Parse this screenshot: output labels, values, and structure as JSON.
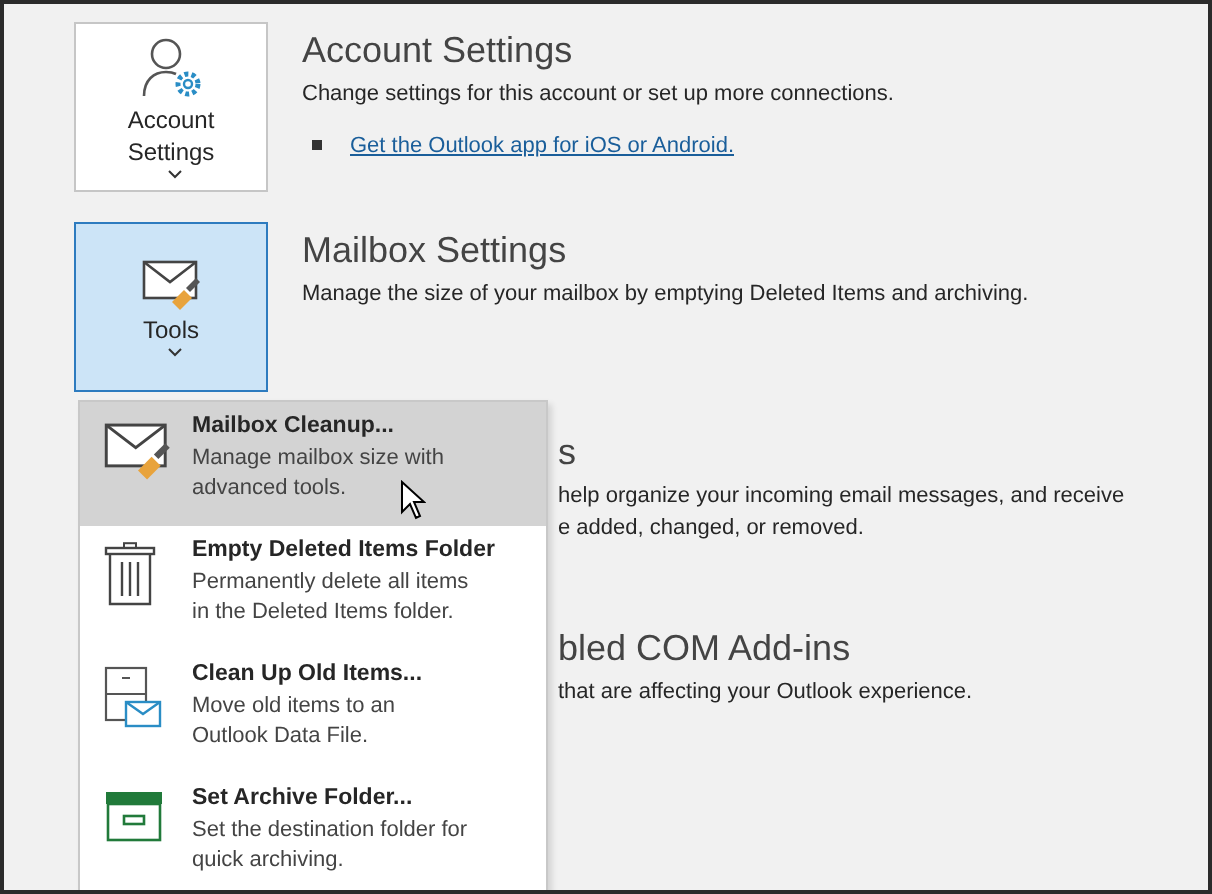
{
  "sections": [
    {
      "button": {
        "label": "Account Settings",
        "selected": false
      },
      "heading": "Account Settings",
      "description": "Change settings for this account or set up more connections.",
      "links": [
        "Get the Outlook app for iOS or Android."
      ]
    },
    {
      "button": {
        "label": "Tools",
        "selected": true
      },
      "heading": "Mailbox Settings",
      "description": "Manage the size of your mailbox by emptying Deleted Items and archiving."
    },
    {
      "heading": "s",
      "description_lines": [
        "help organize your incoming email messages, and receive",
        "e added, changed, or removed."
      ]
    },
    {
      "heading": "bled COM Add-ins",
      "description_lines": [
        "that are affecting your Outlook experience."
      ]
    }
  ],
  "tools_menu": [
    {
      "title": "Mailbox Cleanup...",
      "description": "Manage mailbox size with advanced tools.",
      "selected": true
    },
    {
      "title": "Empty Deleted Items Folder",
      "description": "Permanently delete all items in the Deleted Items folder.",
      "selected": false
    },
    {
      "title": "Clean Up Old Items...",
      "description": "Move old items to an Outlook Data File.",
      "selected": false
    },
    {
      "title": "Set Archive Folder...",
      "description": "Set the destination folder for quick archiving.",
      "selected": false
    }
  ]
}
